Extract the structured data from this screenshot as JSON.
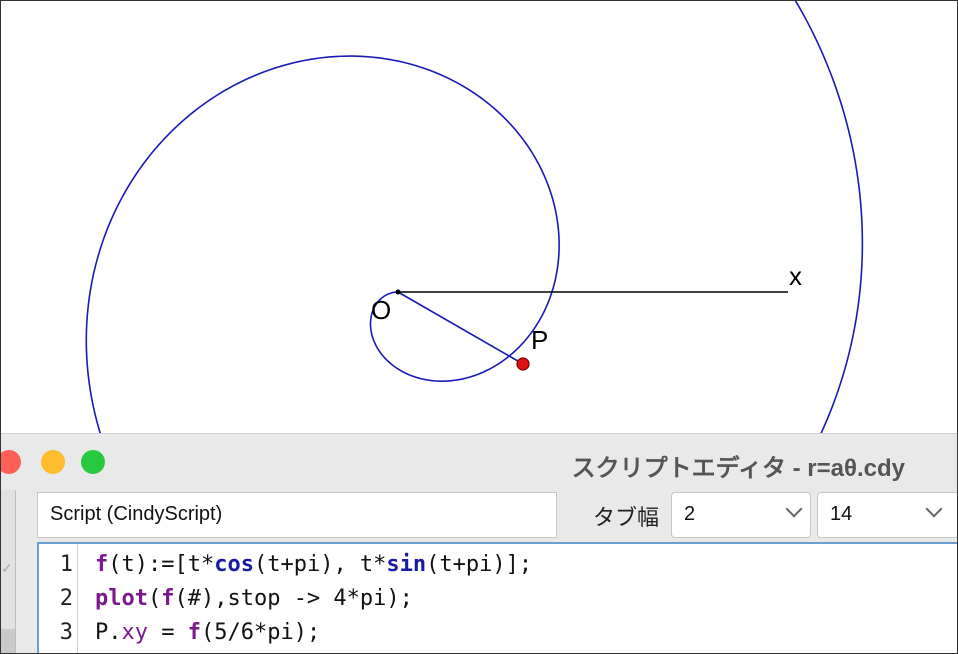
{
  "canvas": {
    "labels": {
      "origin": "O",
      "point": "P",
      "axis": "x"
    },
    "colors": {
      "curve": "#1a1ab8",
      "point": "#e01010",
      "axis": "#000000"
    }
  },
  "editor": {
    "window_title": "スクリプトエディタ - r=aθ.cdy",
    "script_label": "Script (CindyScript)",
    "tab_width_label": "タブ幅",
    "tab_width_value": "2",
    "font_size_value": "14",
    "lines": [
      {
        "number": "1",
        "code": "f(t):=[t*cos(t+pi), t*sin(t+pi)];"
      },
      {
        "number": "2",
        "code": "plot(f(#),stop -> 4*pi);"
      },
      {
        "number": "3",
        "code": "P.xy = f(5/6*pi);"
      }
    ]
  },
  "window_controls": {
    "close_color": "#ff5f57",
    "minimize_color": "#febc2e",
    "zoom_color": "#28c840"
  }
}
